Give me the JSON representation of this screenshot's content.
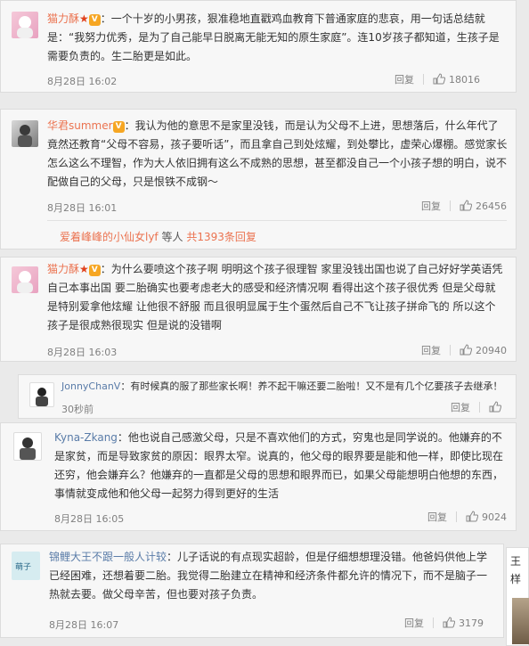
{
  "comments": [
    {
      "user": "猫力酥",
      "text": "：一个十岁的小男孩，狠准稳地直戳鸡血教育下普通家庭的悲哀，用一句话总结就是：“我努力优秀，是为了自己能早日脱离无能无知的原生家庭”。连10岁孩子都知道，生孩子是需要负责的。生二胎更是如此。",
      "time": "8月28日 16:02",
      "reply_label": "回复",
      "likes": "18016"
    },
    {
      "user": "华君summer",
      "text": "：我认为他的意思不是家里没钱，而是认为父母不上进，思想落后，什么年代了竟然还教育“父母不容易，孩子要听话”，而且拿自己到处炫耀，到处攀比，虚荣心爆棚。感觉家长怎么这么不理智，作为大人依旧拥有这么不成熟的思想，甚至都没自己一个小孩子想的明白，说不配做自己的父母，只是恨铁不成钢～",
      "time": "8月28日 16:01",
      "reply_label": "回复",
      "likes": "26456",
      "more_user": "爱着峰峰的小仙女lyf",
      "more_mid": " 等人 ",
      "more_count": "共1393条回复"
    },
    {
      "user": "猫力酥",
      "text": "：为什么要喷这个孩子啊 明明这个孩子很理智 家里没钱出国也说了自己好好学英语凭自己本事出国 要二胎确实也要考虑老大的感受和经济情况啊 看得出这个孩子很优秀 但是父母就是特别爱拿他炫耀 让他很不舒服 而且很明显属于生个蛋然后自己不飞让孩子拼命飞的 所以这个孩子是很成熟很现实 但是说的没错啊",
      "time": "8月28日 16:03",
      "reply_label": "回复",
      "likes": "20940"
    },
    {
      "user": "JonnyChanV",
      "text": "：有时候真的服了那些家长啊！养不起干嘛还要二胎啦！又不是有几个亿要孩子去继承！",
      "time": "30秒前",
      "reply_label": "回复",
      "likes": ""
    },
    {
      "user": "Kyna-Zkang",
      "text": "：他也说自己感激父母，只是不喜欢他们的方式，穷鬼也是同学说的。他嫌弃的不是家贫，而是导致家贫的原因：眼界太窄。说真的，他父母的眼界要是能和他一样，即使比现在还穷，他会嫌弃么？他嫌弃的一直都是父母的思想和眼界而已，如果父母能想明白他想的东西，事情就变成他和他父母一起努力得到更好的生活",
      "time": "8月28日 16:05",
      "reply_label": "回复",
      "likes": "9024"
    },
    {
      "user": "锦鲤大王不跟一般人计较",
      "text": "：儿子话说的有点现实超龄，但是仔细想想理没错。他爸妈供他上学已经困难，还想着要二胎。我觉得二胎建立在精神和经济条件都允许的情况下，而不是脑子一热就去要。做父母辛苦，但也要对孩子负责。",
      "time": "8月28日 16:07",
      "reply_label": "回复",
      "likes": "3179"
    }
  ],
  "side_text": [
    "王",
    "样"
  ],
  "colors": {
    "name": "#eb7350",
    "meta": "#808080",
    "card_bg": "#f7f7f7",
    "page_bg": "#eaeaea"
  }
}
